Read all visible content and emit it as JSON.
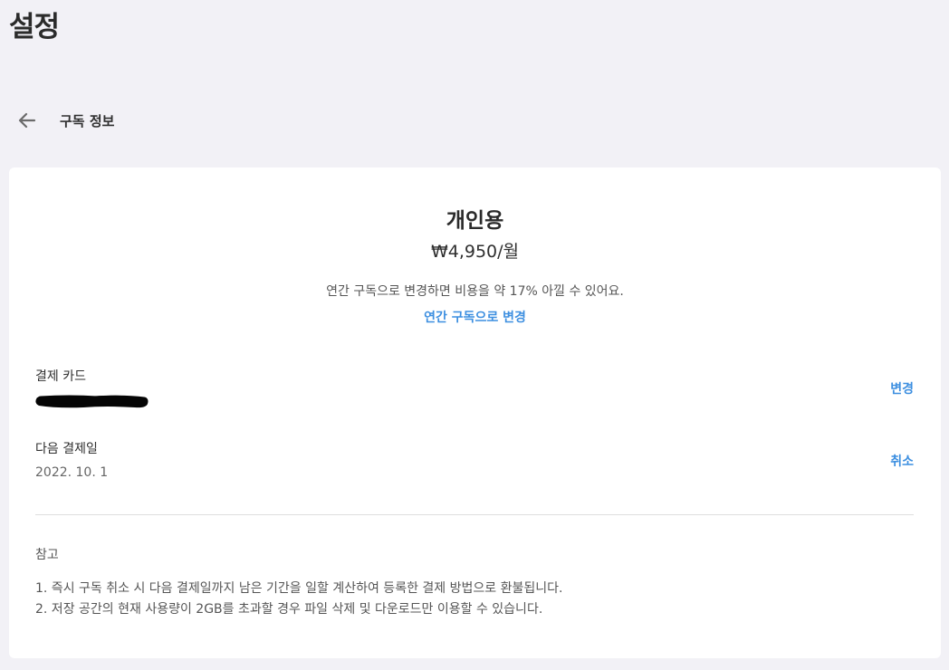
{
  "page_title": "설정",
  "header": {
    "back_icon": "arrow-left-icon",
    "section_title": "구독 정보"
  },
  "plan": {
    "name": "개인용",
    "price": "₩4,950/월",
    "annual_note": "연간 구독으로 변경하면 비용을 약 17% 아낄 수 있어요.",
    "annual_link": "연간 구독으로 변경"
  },
  "payment_card": {
    "label": "결제 카드",
    "action": "변경"
  },
  "next_payment": {
    "label": "다음 결제일",
    "date": "2022. 10. 1",
    "action": "취소"
  },
  "notes": {
    "title": "참고",
    "items": [
      "1. 즉시 구독 취소 시 다음 결제일까지 남은 기간을 일할 계산하여 등록한 결제 방법으로 환불됩니다.",
      "2. 저장 공간의 현재 사용량이 2GB를 초과할 경우 파일 삭제 및 다운로드만 이용할 수 있습니다."
    ]
  },
  "colors": {
    "background": "#f2f1f6",
    "card": "#ffffff",
    "accent": "#3d8fe0",
    "text": "#2f2f2f"
  }
}
